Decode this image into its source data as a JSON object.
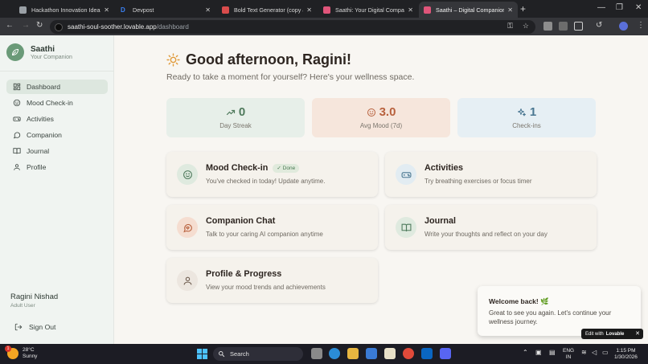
{
  "browser": {
    "tabs": [
      {
        "title": "Hackathon Innovation Ideas",
        "color": "#9aa0a6"
      },
      {
        "title": "Devpost",
        "color": "#3b82f6"
      },
      {
        "title": "Bold Text Generator (copy & p",
        "color": "#d94c4c"
      },
      {
        "title": "Saathi: Your Digital Companion",
        "color": "#e0557a"
      },
      {
        "title": "Saathi – Digital Companion for",
        "color": "#e0557a"
      }
    ],
    "url_host": "saathi-soul-soother.lovable.app",
    "url_path": "/dashboard"
  },
  "brand": {
    "name": "Saathi",
    "subtitle": "Your Companion"
  },
  "nav": [
    {
      "label": "Dashboard",
      "icon": "dashboard-icon",
      "active": true
    },
    {
      "label": "Mood Check-in",
      "icon": "smile-icon",
      "active": false
    },
    {
      "label": "Activities",
      "icon": "gamepad-icon",
      "active": false
    },
    {
      "label": "Companion",
      "icon": "chat-icon",
      "active": false
    },
    {
      "label": "Journal",
      "icon": "book-icon",
      "active": false
    },
    {
      "label": "Profile",
      "icon": "user-icon",
      "active": false
    }
  ],
  "user": {
    "name": "Ragini Nishad",
    "role": "Adult User",
    "signout": "Sign Out"
  },
  "greeting": {
    "title": "Good afternoon, Ragini!",
    "subtitle": "Ready to take a moment for yourself? Here's your wellness space."
  },
  "stats": [
    {
      "value": "0",
      "label": "Day Streak",
      "icon": "trend-up-icon",
      "bg": "#e7efe9",
      "color": "#4f7a5c"
    },
    {
      "value": "3.0",
      "label": "Avg Mood (7d)",
      "icon": "smile-icon",
      "bg": "#f6e6dc",
      "color": "#b8613d"
    },
    {
      "value": "1",
      "label": "Check-ins",
      "icon": "sparkles-icon",
      "bg": "#e6eff4",
      "color": "#4a7791"
    }
  ],
  "cards": [
    {
      "title": "Mood Check-in",
      "badge": "✓ Done",
      "desc": "You've checked in today! Update anytime.",
      "icon": "smile-icon",
      "bubble": "#dfeadf",
      "color": "#4f7a5c"
    },
    {
      "title": "Activities",
      "desc": "Try breathing exercises or focus timer",
      "icon": "gamepad-icon",
      "bubble": "#e2ecf2",
      "color": "#4a7791"
    },
    {
      "title": "Companion Chat",
      "desc": "Talk to your caring AI companion anytime",
      "icon": "chat-icon",
      "bubble": "#f5ddd0",
      "color": "#b8613d"
    },
    {
      "title": "Journal",
      "desc": "Write your thoughts and reflect on your day",
      "icon": "book-icon",
      "bubble": "#dfeadf",
      "color": "#4f7a5c"
    },
    {
      "title": "Profile & Progress",
      "desc": "View your mood trends and achievements",
      "icon": "user-icon",
      "bubble": "#ece6df",
      "color": "#6f5d4f"
    }
  ],
  "toast": {
    "title": "Welcome back! 🌿",
    "body": "Great to see you again. Let's continue your wellness journey."
  },
  "lovable": {
    "prefix": "Edit with",
    "brand": "Lovable"
  },
  "taskbar": {
    "temp": "28°C",
    "weather": "Sunny",
    "badge": "1",
    "search": "Search",
    "lang1": "ENG",
    "lang2": "IN",
    "time": "1:15 PM",
    "date": "1/30/2026"
  }
}
